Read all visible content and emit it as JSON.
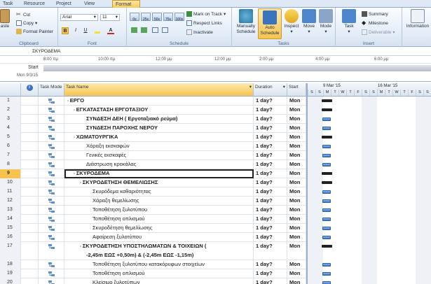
{
  "tabs": [
    {
      "label": "Task",
      "active": false
    },
    {
      "label": "Resource",
      "active": false
    },
    {
      "label": "Project",
      "active": false
    },
    {
      "label": "View",
      "active": false
    },
    {
      "label": "Format",
      "active": true
    }
  ],
  "ribbon": {
    "clipboard": {
      "paste": "aste",
      "cut": "Cut",
      "copy": "Copy",
      "format_painter": "Format Painter",
      "group": "Clipboard"
    },
    "font": {
      "family": "Arial",
      "size": "11",
      "bold": "B",
      "italic": "I",
      "underline": "U",
      "group": "Font"
    },
    "schedule": {
      "mark_on_track": "Mark on Track",
      "respect_links": "Respect Links",
      "inactivate": "Inactivate",
      "group": "Schedule",
      "pct": [
        "0x",
        "25x",
        "50x",
        "75x",
        "100x"
      ]
    },
    "tasks": {
      "manually": "Manually",
      "schedule": "Schedule",
      "auto": "Auto",
      "auto_schedule": "Schedule",
      "inspect": "Inspect",
      "move": "Move",
      "mode": "Mode",
      "group": "Tasks"
    },
    "insert": {
      "task": "Task",
      "summary": "Summary",
      "milestone": "Milestone",
      "deliverable": "Deliverable",
      "group": "Insert"
    },
    "properties": {
      "information": "Information"
    }
  },
  "entry_bar": {
    "value": "ΣΚΥΡΟΔΕΜΑ"
  },
  "timeline": {
    "start_label": "Start",
    "start_date": "Mon 9/3/15",
    "times": [
      "8:00 πμ",
      "10:00 πμ",
      "12:00 μμ",
      "2:00 μμ",
      "4:00 μμ",
      "6:00 μμ"
    ]
  },
  "columns": {
    "info": "i",
    "mode": "Task Mode",
    "name": "Task Name",
    "duration": "Duration",
    "start": "Start"
  },
  "gantt_header": {
    "week1": "9 Mar '15",
    "week2": "16 Mar '15",
    "days": [
      "S",
      "S",
      "M",
      "T",
      "W",
      "T",
      "F",
      "S",
      "S",
      "M",
      "T",
      "W",
      "T",
      "F",
      "S",
      "S"
    ]
  },
  "tasks": [
    {
      "id": "1",
      "name": "ΕΡΓΟ",
      "level": 0,
      "bold": true,
      "summary": true,
      "duration": "1 day?",
      "start": "Mon",
      "selected": false
    },
    {
      "id": "2",
      "name": "ΕΓΚΑΤΑΣΤΑΣΗ ΕΡΓΟΤΑΞΙΟΥ",
      "level": 1,
      "bold": true,
      "summary": true,
      "duration": "1 day?",
      "start": "Mon",
      "selected": false
    },
    {
      "id": "3",
      "name": "ΣΥΝΔΕΣΗ ΔΕΗ ( Εργοταξιακό ρεύμα)",
      "level": 2,
      "bold": true,
      "summary": false,
      "duration": "1 day?",
      "start": "Mon",
      "selected": false
    },
    {
      "id": "4",
      "name": "ΣΥΝΔΕΣΗ ΠΑΡΟΧΗΣ ΝΕΡΟΥ",
      "level": 2,
      "bold": true,
      "summary": false,
      "duration": "1 day?",
      "start": "Mon",
      "selected": false
    },
    {
      "id": "5",
      "name": "ΧΩΜΑΤΟΥΡΓΙΚΑ",
      "level": 1,
      "bold": true,
      "summary": true,
      "duration": "1 day?",
      "start": "Mon",
      "selected": false
    },
    {
      "id": "6",
      "name": "Χάραξη εκσκαφών",
      "level": 2,
      "bold": false,
      "summary": false,
      "duration": "1 day?",
      "start": "Mon",
      "selected": false
    },
    {
      "id": "7",
      "name": "Γενικές εκσκαφές",
      "level": 2,
      "bold": false,
      "summary": false,
      "duration": "1 day?",
      "start": "Mon",
      "selected": false
    },
    {
      "id": "8",
      "name": "Διάστρωση κροκάλας",
      "level": 2,
      "bold": false,
      "summary": false,
      "duration": "1 day?",
      "start": "Mon",
      "selected": false
    },
    {
      "id": "9",
      "name": "ΣΚΥΡΟΔΕΜΑ",
      "level": 1,
      "bold": true,
      "summary": true,
      "duration": "1 day?",
      "start": "Mon",
      "selected": true
    },
    {
      "id": "10",
      "name": "ΣΚΥΡΟΔΕΤΗΣΗ ΘΕΜΕΛΙΩΣΗΣ",
      "level": 2,
      "bold": true,
      "summary": true,
      "duration": "1 day?",
      "start": "Mon",
      "selected": false
    },
    {
      "id": "11",
      "name": "Σκυρόδεμα καθαριότητας",
      "level": 3,
      "bold": false,
      "summary": false,
      "duration": "1 day?",
      "start": "Mon",
      "selected": false
    },
    {
      "id": "12",
      "name": "Χάραξη θεμελίωσης",
      "level": 3,
      "bold": false,
      "summary": false,
      "duration": "1 day?",
      "start": "Mon",
      "selected": false
    },
    {
      "id": "13",
      "name": "Τοποθέτηση ξυλοτύπου",
      "level": 3,
      "bold": false,
      "summary": false,
      "duration": "1 day?",
      "start": "Mon",
      "selected": false
    },
    {
      "id": "14",
      "name": "Τοποθέτηση οπλισμού",
      "level": 3,
      "bold": false,
      "summary": false,
      "duration": "1 day?",
      "start": "Mon",
      "selected": false
    },
    {
      "id": "15",
      "name": "Σκυροδέτηση θεμελίωσης",
      "level": 3,
      "bold": false,
      "summary": false,
      "duration": "1 day?",
      "start": "Mon",
      "selected": false
    },
    {
      "id": "16",
      "name": "Αφαίρεση ξυλοτύπου",
      "level": 3,
      "bold": false,
      "summary": false,
      "duration": "1 day?",
      "start": "Mon",
      "selected": false
    },
    {
      "id": "17",
      "name": "ΣΚΥΡΟΔΕΤΗΣΗ ΥΠΟΣΤΗΛΩΜΑΤΩΝ & ΤΟΙΧΕΙΩΝ (",
      "name2": "-2,45m ΕΩΣ +0,50m) & (-2,45m ΕΩΣ -1,15m)",
      "level": 2,
      "bold": true,
      "summary": true,
      "duration": "1 day?",
      "start": "Mon",
      "selected": false
    },
    {
      "id": "18",
      "name": "Τοποθέτηση ξυλοτύπου κατακόρυφων στοιχείων",
      "level": 3,
      "bold": false,
      "summary": false,
      "duration": "1 day?",
      "start": "Mon",
      "selected": false
    },
    {
      "id": "19",
      "name": "Τοποθέτηση οπλισμού",
      "level": 3,
      "bold": false,
      "summary": false,
      "duration": "1 day?",
      "start": "Mon",
      "selected": false
    },
    {
      "id": "20",
      "name": "Κλείσιμο ξυλοτύπων",
      "level": 3,
      "bold": false,
      "summary": false,
      "duration": "1 day?",
      "start": "Mon",
      "selected": false
    }
  ],
  "colors": {
    "accent": "#f7c34a",
    "bar": "#4a84d0",
    "summary": "#222222",
    "ribbon": "#dfe9f5"
  }
}
